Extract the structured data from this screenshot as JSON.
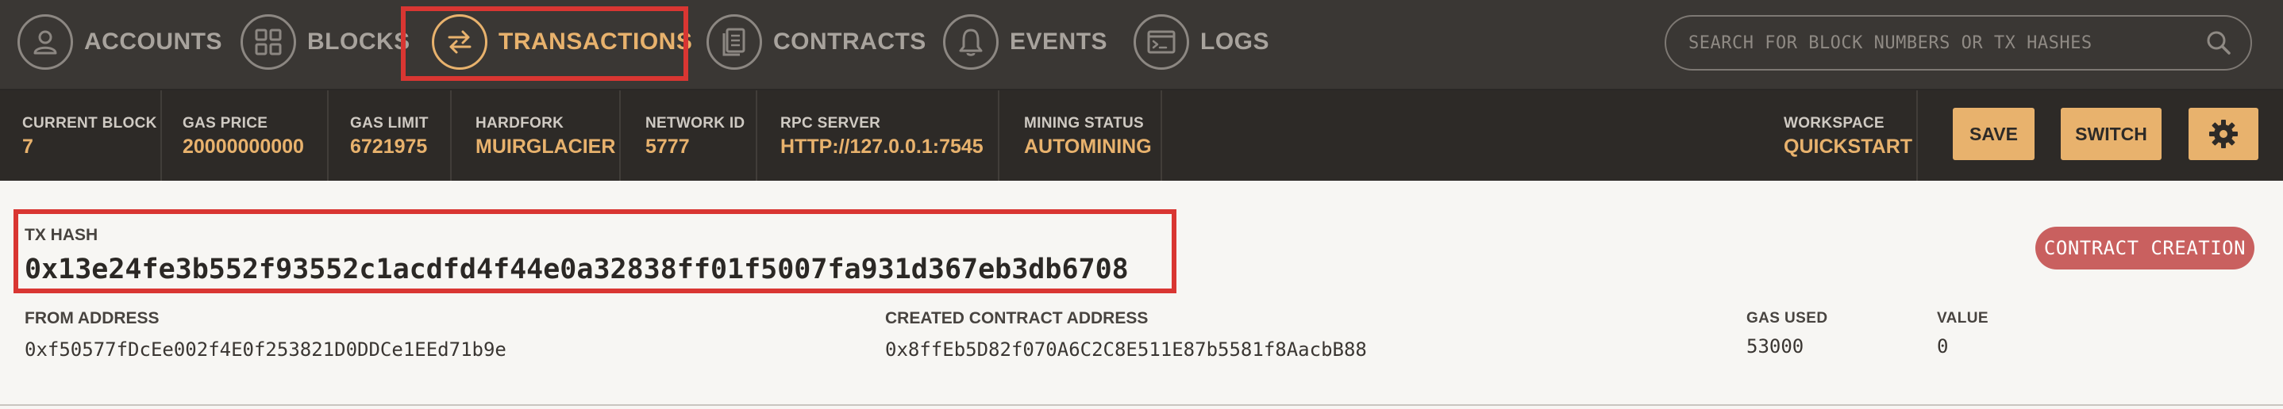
{
  "nav": {
    "items": [
      {
        "label": "ACCOUNTS",
        "icon": "account-icon"
      },
      {
        "label": "BLOCKS",
        "icon": "blocks-icon"
      },
      {
        "label": "TRANSACTIONS",
        "icon": "transactions-icon"
      },
      {
        "label": "CONTRACTS",
        "icon": "contracts-icon"
      },
      {
        "label": "EVENTS",
        "icon": "bell-icon"
      },
      {
        "label": "LOGS",
        "icon": "terminal-icon"
      }
    ],
    "active": "TRANSACTIONS",
    "search_placeholder": "SEARCH FOR BLOCK NUMBERS OR TX HASHES"
  },
  "status": {
    "current_block": {
      "label": "CURRENT BLOCK",
      "value": "7"
    },
    "gas_price": {
      "label": "GAS PRICE",
      "value": "20000000000"
    },
    "gas_limit": {
      "label": "GAS LIMIT",
      "value": "6721975"
    },
    "hardfork": {
      "label": "HARDFORK",
      "value": "MUIRGLACIER"
    },
    "network_id": {
      "label": "NETWORK ID",
      "value": "5777"
    },
    "rpc_server": {
      "label": "RPC SERVER",
      "value": "HTTP://127.0.0.1:7545"
    },
    "mining_status": {
      "label": "MINING STATUS",
      "value": "AUTOMINING"
    },
    "workspace": {
      "label": "WORKSPACE",
      "value": "QUICKSTART"
    },
    "save_label": "SAVE",
    "switch_label": "SWITCH"
  },
  "tx": {
    "hash_label": "TX HASH",
    "hash": "0x13e24fe3b552f93552c1acdfd4f44e0a32838ff01f5007fa931d367eb3db6708",
    "badge": "CONTRACT CREATION",
    "from_label": "FROM ADDRESS",
    "from": "0xf50577fDcEe002f4E0f253821D0DDCe1EEd71b9e",
    "created_label": "CREATED CONTRACT ADDRESS",
    "created": "0x8ffEb5D82f070A6C2C8E511E87b5581f8AacbB88",
    "gas_used_label": "GAS USED",
    "gas_used": "53000",
    "value_label": "VALUE",
    "value": "0"
  },
  "colors": {
    "accent": "#e8b26d",
    "highlight": "#d93632",
    "badge": "#c9605f",
    "nav_bg": "#3a3734",
    "status_bg": "#2d2a27"
  }
}
